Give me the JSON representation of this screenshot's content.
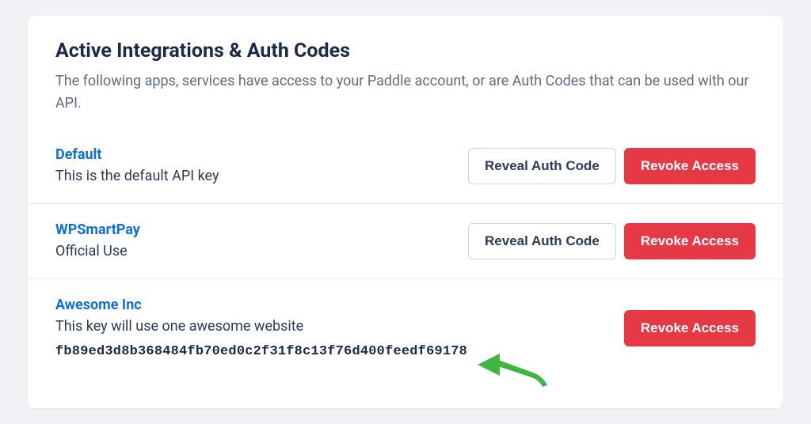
{
  "header": {
    "title": "Active Integrations & Auth Codes",
    "description": "The following apps, services have access to your Paddle account, or are Auth Codes that can be used with our API."
  },
  "buttons": {
    "reveal": "Reveal Auth Code",
    "revoke": "Revoke Access"
  },
  "integrations": [
    {
      "name": "Default",
      "description": "This is the default API key",
      "revealed": false,
      "auth_code": null
    },
    {
      "name": "WPSmartPay",
      "description": "Official Use",
      "revealed": false,
      "auth_code": null
    },
    {
      "name": "Awesome Inc",
      "description": "This key will use one awesome website",
      "revealed": true,
      "auth_code": "fb89ed3d8b368484fb70ed0c2f31f8c13f76d400feedf69178"
    }
  ],
  "colors": {
    "link_blue": "#0f6fde",
    "danger_red": "#e63946",
    "text_dark": "#1b2a47",
    "text_muted": "#5e6b80",
    "arrow_green": "#3fb63f"
  }
}
